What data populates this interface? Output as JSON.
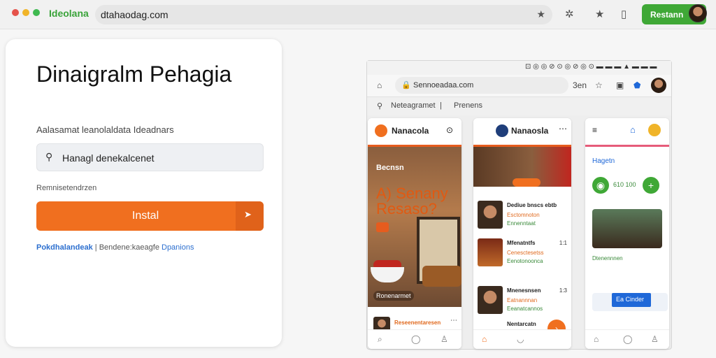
{
  "browser": {
    "brand": "Ideolana",
    "url": "dtahaodag.com",
    "action_button": "Restann",
    "colors": {
      "brand": "#3aa33a",
      "accent": "#f06f1f"
    }
  },
  "card": {
    "title": "Dinaigralm Pehagia",
    "subtitle": "Aalasamat leanolaldata Ideadnars",
    "search_value": "Hanagl denekalcenet",
    "recommend_label": "Remnisetendrzen",
    "install_label": "Instal",
    "links": {
      "first": "Pokdhalandeak",
      "middle": "Bendene:kaeagfe",
      "last": "Dpanions"
    }
  },
  "mock": {
    "url": "Sennoeadaa.com",
    "nav_label": "3en",
    "breadcrumb": {
      "first": "Neteagramet",
      "second": "Prenens"
    },
    "phone1": {
      "title": "Nanacola",
      "hero_tag": "Becnsn",
      "hero_headline": "A) Senany Resaso?",
      "hero_caption": "Ronenarmet",
      "footer_name": "Reseenentaresen"
    },
    "phone2": {
      "title": "Nanaosla",
      "rows": [
        {
          "t1": "Dediue bnscs ebtb",
          "t2": "Esctomnoton",
          "t3": "Ennenntaat",
          "n": ""
        },
        {
          "t1": "Mfenatntfs",
          "t2": "Cenesctesetss",
          "t3": "Eenotonoonca",
          "n": "1:1"
        },
        {
          "t1": "Mnenesnsen",
          "t2": "Eatnannnan",
          "t3": "Eeanatcannos",
          "n": "1:3"
        },
        {
          "t1": "Nentarcatn",
          "t2": "",
          "t3": "",
          "n": ""
        }
      ]
    },
    "phone3": {
      "section": "Hagetn",
      "stats": "610 100",
      "button": "Ea Cinder",
      "food_text": "Dtenennnen"
    }
  }
}
